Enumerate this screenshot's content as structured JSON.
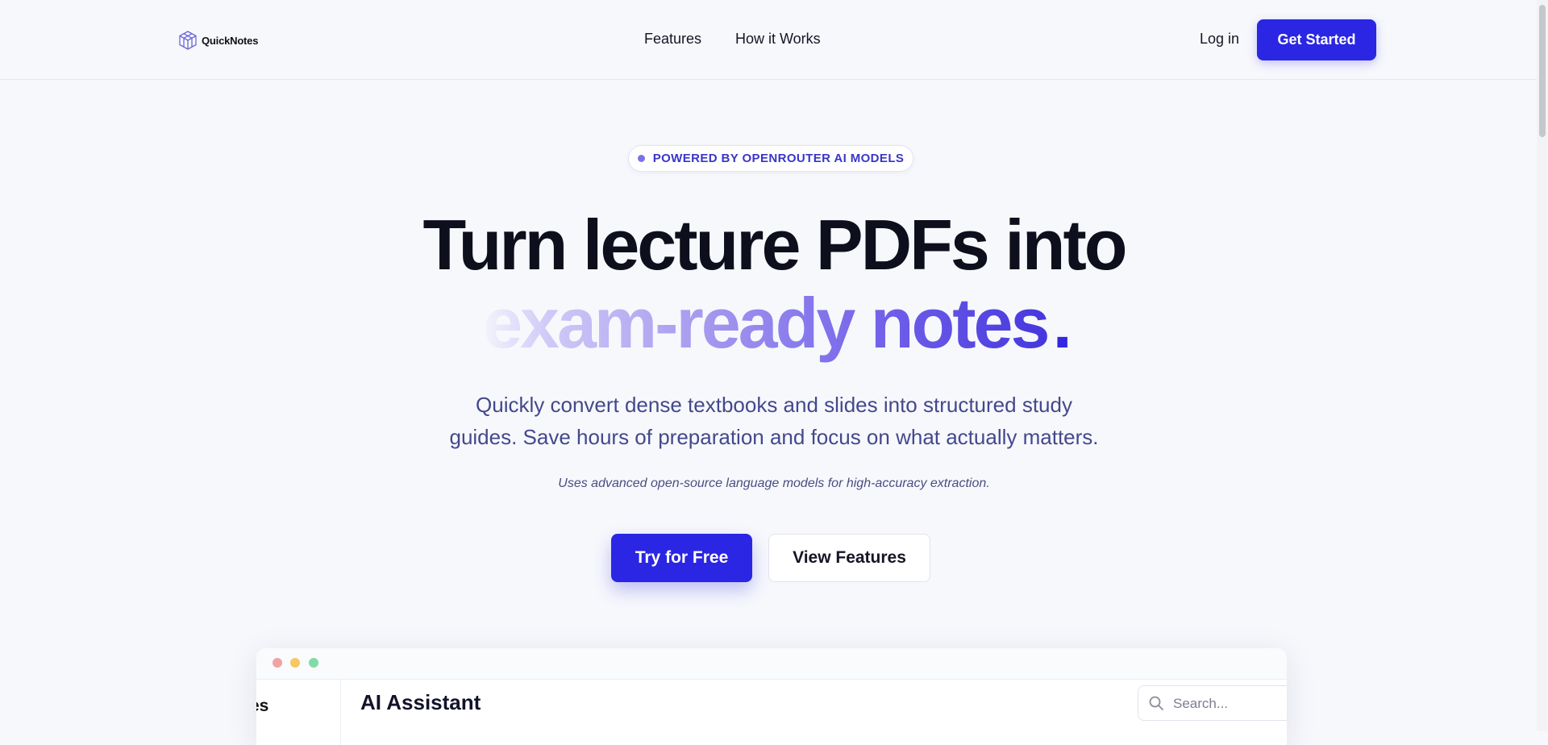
{
  "header": {
    "brand": "QuickNotes",
    "nav": [
      "Features",
      "How it Works"
    ],
    "login_label": "Log in",
    "cta_label": "Get Started"
  },
  "hero": {
    "badge": "POWERED BY OPENROUTER AI MODELS",
    "headline_line1": "Turn lecture PDFs into",
    "headline_line2": "exam-ready notes",
    "headline_punct": ".",
    "subtitle_line1": "Quickly convert dense textbooks and slides into structured study",
    "subtitle_line2": "guides. Save hours of preparation and focus on what actually matters.",
    "note": "Uses advanced open-source language models for high-accuracy extraction.",
    "primary_cta": "Try for Free",
    "secondary_cta": "View Features"
  },
  "preview": {
    "sidebar_label_partial": "es",
    "title": "AI Assistant",
    "search_placeholder": "Search..."
  },
  "colors": {
    "accent": "#2a26e3",
    "background": "#f7f8fc",
    "headline": "#0e0f1c",
    "subtitle": "#44488c"
  },
  "icons": [
    "logo-cube-icon",
    "search-icon"
  ]
}
